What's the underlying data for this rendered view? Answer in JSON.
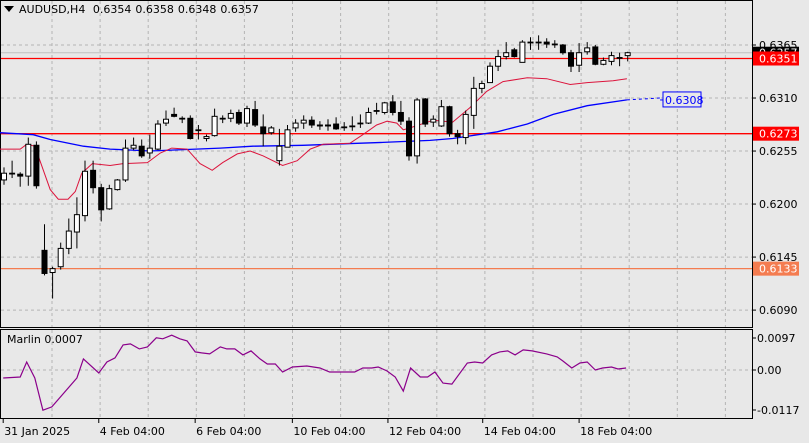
{
  "header": {
    "symbol": "AUDUSD,H4",
    "open": "0.6354",
    "high": "0.6358",
    "low": "0.6348",
    "close": "0.6357"
  },
  "price_axis": {
    "labels": [
      "0.6365",
      "0.6310",
      "0.6255",
      "0.6200",
      "0.6145",
      "0.6090"
    ],
    "current_price": "0.6357"
  },
  "levels": [
    {
      "label": "0.6351",
      "price": 0.6351,
      "color": "#ff0000"
    },
    {
      "label": "0.6273",
      "price": 0.6273,
      "color": "#ff0000"
    },
    {
      "label": "0.6133",
      "price": 0.6133,
      "color": "#f47c50"
    }
  ],
  "ma_label": {
    "label": "0.6308",
    "price": 0.6308,
    "color": "#0000ff"
  },
  "time_axis": {
    "labels": [
      "31 Jan 2025",
      "4 Feb 04:00",
      "6 Feb 04:00",
      "10 Feb 04:00",
      "12 Feb 04:00",
      "14 Feb 04:00",
      "18 Feb 04:00"
    ],
    "label_bars": [
      -0.1,
      11.7,
      23.6,
      35.6,
      47.4,
      59.1,
      71
    ]
  },
  "oscillator": {
    "title": "Marlin 0.0007",
    "axis_labels": [
      "0.0097",
      "0.00",
      "-0.0117"
    ],
    "color": "#8b008b",
    "points": [
      [
        -0.1,
        -0.0024
      ],
      [
        2,
        -0.0021
      ],
      [
        2.8,
        0.0024
      ],
      [
        3.8,
        -0.0024
      ],
      [
        4.8,
        -0.012
      ],
      [
        5.9,
        -0.011
      ],
      [
        9,
        -0.0024
      ],
      [
        9.8,
        0.0033
      ],
      [
        11.7,
        -0.0009
      ],
      [
        12.7,
        0.0024
      ],
      [
        13.7,
        0.0036
      ],
      [
        14.7,
        0.0075
      ],
      [
        15.6,
        0.0078
      ],
      [
        16.7,
        0.0063
      ],
      [
        17.7,
        0.0069
      ],
      [
        18.8,
        0.0096
      ],
      [
        19.6,
        0.0093
      ],
      [
        20.7,
        0.0104
      ],
      [
        21.7,
        0.0093
      ],
      [
        22.6,
        0.0087
      ],
      [
        23.6,
        0.0054
      ],
      [
        24.4,
        0.0051
      ],
      [
        25.4,
        0.0048
      ],
      [
        26.7,
        0.0069
      ],
      [
        27.5,
        0.0063
      ],
      [
        28.5,
        0.0063
      ],
      [
        29.5,
        0.0045
      ],
      [
        30.5,
        0.0057
      ],
      [
        31.6,
        0.0033
      ],
      [
        32.5,
        0.0018
      ],
      [
        33.5,
        0.0018
      ],
      [
        34.4,
        -0.0006
      ],
      [
        35.6,
        0.0009
      ],
      [
        37.4,
        0.0012
      ],
      [
        39,
        0.0006
      ],
      [
        40.2,
        -0.0006
      ],
      [
        43.3,
        -0.0006
      ],
      [
        44.3,
        0.0006
      ],
      [
        45.4,
        0.0006
      ],
      [
        46.2,
        0.0009
      ],
      [
        47.3,
        -0.0003
      ],
      [
        48.3,
        -0.0021
      ],
      [
        49.3,
        -0.0063
      ],
      [
        50.2,
        0.0006
      ],
      [
        51.4,
        -0.0021
      ],
      [
        52.3,
        -0.0021
      ],
      [
        53.2,
        -0.0006
      ],
      [
        54.2,
        -0.0039
      ],
      [
        55.3,
        -0.0042
      ],
      [
        57.2,
        0.0021
      ],
      [
        58.1,
        0.0024
      ],
      [
        59.1,
        0.0021
      ],
      [
        60.2,
        0.0045
      ],
      [
        61.2,
        0.0054
      ],
      [
        62.2,
        0.0057
      ],
      [
        63.1,
        0.0045
      ],
      [
        64.1,
        0.006
      ],
      [
        65.2,
        0.0057
      ],
      [
        67,
        0.0048
      ],
      [
        68.3,
        0.0039
      ],
      [
        69,
        0.0027
      ],
      [
        70.1,
        0.0006
      ],
      [
        71.1,
        0.0021
      ],
      [
        72,
        0.0024
      ],
      [
        73,
        0
      ],
      [
        73.9,
        0.0006
      ],
      [
        75,
        0.0009
      ],
      [
        75.8,
        0.0003
      ],
      [
        76.8,
        0.0006
      ]
    ]
  },
  "chart_data": {
    "type": "candlestick",
    "ohlc": [
      [
        0.6225,
        0.6238,
        0.622,
        0.6232
      ],
      [
        0.6232,
        0.6245,
        0.6227,
        0.6232
      ],
      [
        0.6231,
        0.6233,
        0.6218,
        0.6229
      ],
      [
        0.6229,
        0.6269,
        0.6219,
        0.6262
      ],
      [
        0.6261,
        0.6265,
        0.6216,
        0.6219
      ],
      [
        0.6152,
        0.6179,
        0.6126,
        0.6128
      ],
      [
        0.6129,
        0.6135,
        0.6102,
        0.6133
      ],
      [
        0.6135,
        0.616,
        0.6132,
        0.6154
      ],
      [
        0.6154,
        0.6185,
        0.6148,
        0.6172
      ],
      [
        0.6171,
        0.6207,
        0.6154,
        0.6189
      ],
      [
        0.6188,
        0.6245,
        0.6182,
        0.6234
      ],
      [
        0.6235,
        0.6245,
        0.6211,
        0.6217
      ],
      [
        0.6217,
        0.6221,
        0.6182,
        0.6194
      ],
      [
        0.6195,
        0.622,
        0.6194,
        0.6216
      ],
      [
        0.6215,
        0.6226,
        0.6214,
        0.6225
      ],
      [
        0.6225,
        0.6267,
        0.6223,
        0.6258
      ],
      [
        0.6258,
        0.6269,
        0.6256,
        0.6261
      ],
      [
        0.626,
        0.6267,
        0.6248,
        0.625
      ],
      [
        0.6253,
        0.6272,
        0.6247,
        0.6258
      ],
      [
        0.6257,
        0.6287,
        0.6256,
        0.6283
      ],
      [
        0.6284,
        0.6297,
        0.6281,
        0.6288
      ],
      [
        0.6293,
        0.63,
        0.629,
        0.6291
      ],
      [
        0.6289,
        0.6291,
        0.6284,
        0.6289
      ],
      [
        0.6289,
        0.6292,
        0.6267,
        0.6268
      ],
      [
        0.6277,
        0.6282,
        0.6267,
        0.6277
      ],
      [
        0.6268,
        0.6272,
        0.6265,
        0.627
      ],
      [
        0.6271,
        0.6299,
        0.627,
        0.6291
      ],
      [
        0.6289,
        0.6292,
        0.6284,
        0.6289
      ],
      [
        0.6289,
        0.6298,
        0.6285,
        0.6294
      ],
      [
        0.6295,
        0.6298,
        0.6282,
        0.6284
      ],
      [
        0.6284,
        0.6302,
        0.628,
        0.6299
      ],
      [
        0.6298,
        0.6307,
        0.628,
        0.6282
      ],
      [
        0.628,
        0.6293,
        0.626,
        0.6273
      ],
      [
        0.6274,
        0.6281,
        0.6272,
        0.6279
      ],
      [
        0.6245,
        0.6278,
        0.624,
        0.626
      ],
      [
        0.6259,
        0.6282,
        0.6259,
        0.6277
      ],
      [
        0.6279,
        0.6288,
        0.6275,
        0.6284
      ],
      [
        0.6284,
        0.6292,
        0.6278,
        0.6287
      ],
      [
        0.6287,
        0.6291,
        0.6279,
        0.6282
      ],
      [
        0.6282,
        0.6286,
        0.6277,
        0.6281
      ],
      [
        0.6282,
        0.6288,
        0.6276,
        0.6281
      ],
      [
        0.6283,
        0.629,
        0.6277,
        0.6278
      ],
      [
        0.628,
        0.6285,
        0.6276,
        0.628
      ],
      [
        0.6281,
        0.6291,
        0.6276,
        0.6281
      ],
      [
        0.6284,
        0.6293,
        0.6279,
        0.6284
      ],
      [
        0.6284,
        0.63,
        0.6283,
        0.6295
      ],
      [
        0.6297,
        0.6305,
        0.6293,
        0.6297
      ],
      [
        0.6295,
        0.6306,
        0.6293,
        0.6305
      ],
      [
        0.6306,
        0.6313,
        0.6292,
        0.6295
      ],
      [
        0.6295,
        0.6307,
        0.6282,
        0.6286
      ],
      [
        0.6286,
        0.629,
        0.6245,
        0.625
      ],
      [
        0.625,
        0.631,
        0.6242,
        0.6308
      ],
      [
        0.6309,
        0.631,
        0.628,
        0.6283
      ],
      [
        0.6285,
        0.6292,
        0.628,
        0.6288
      ],
      [
        0.6281,
        0.6308,
        0.628,
        0.6301
      ],
      [
        0.6301,
        0.6302,
        0.627,
        0.6273
      ],
      [
        0.6273,
        0.6277,
        0.6262,
        0.627
      ],
      [
        0.6269,
        0.6297,
        0.6262,
        0.6293
      ],
      [
        0.6292,
        0.6332,
        0.6278,
        0.632
      ],
      [
        0.632,
        0.6328,
        0.6315,
        0.6325
      ],
      [
        0.6326,
        0.6347,
        0.6326,
        0.6343
      ],
      [
        0.6343,
        0.636,
        0.6338,
        0.6353
      ],
      [
        0.6353,
        0.6368,
        0.635,
        0.6357
      ],
      [
        0.636,
        0.6362,
        0.6352,
        0.6353
      ],
      [
        0.6347,
        0.637,
        0.6347,
        0.6368
      ],
      [
        0.6368,
        0.6373,
        0.636,
        0.6368
      ],
      [
        0.6368,
        0.6375,
        0.636,
        0.6368
      ],
      [
        0.6368,
        0.6372,
        0.6362,
        0.6366
      ],
      [
        0.6366,
        0.637,
        0.6362,
        0.6366
      ],
      [
        0.6365,
        0.6366,
        0.6355,
        0.6357
      ],
      [
        0.6357,
        0.636,
        0.6337,
        0.6343
      ],
      [
        0.6344,
        0.6367,
        0.6337,
        0.6357
      ],
      [
        0.6358,
        0.6368,
        0.6355,
        0.6362
      ],
      [
        0.6363,
        0.6365,
        0.6344,
        0.6345
      ],
      [
        0.6345,
        0.6352,
        0.6344,
        0.6349
      ],
      [
        0.6348,
        0.6358,
        0.6344,
        0.6354
      ],
      [
        0.6352,
        0.6357,
        0.6343,
        0.6352
      ],
      [
        0.6354,
        0.6358,
        0.6348,
        0.6357
      ]
    ],
    "ma_fast": {
      "color": "#dc143c",
      "points": [
        [
          -0.5,
          0.6257
        ],
        [
          2,
          0.6257
        ],
        [
          2.8,
          0.6262
        ],
        [
          3.8,
          0.626
        ],
        [
          5.7,
          0.6215
        ],
        [
          6.7,
          0.6205
        ],
        [
          7.9,
          0.6205
        ],
        [
          8.8,
          0.6213
        ],
        [
          9.6,
          0.6232
        ],
        [
          10.9,
          0.6242
        ],
        [
          13.1,
          0.624
        ],
        [
          14.7,
          0.6242
        ],
        [
          17.7,
          0.6243
        ],
        [
          19.3,
          0.6253
        ],
        [
          20.7,
          0.6258
        ],
        [
          22.6,
          0.6257
        ],
        [
          24.2,
          0.6242
        ],
        [
          25.7,
          0.6235
        ],
        [
          27,
          0.6243
        ],
        [
          28.8,
          0.6252
        ],
        [
          30.4,
          0.6255
        ],
        [
          32,
          0.625
        ],
        [
          34.4,
          0.624
        ],
        [
          36.2,
          0.6245
        ],
        [
          37.8,
          0.6257
        ],
        [
          39.4,
          0.6262
        ],
        [
          42.7,
          0.6263
        ],
        [
          44.3,
          0.6272
        ],
        [
          46,
          0.6282
        ],
        [
          47.3,
          0.6286
        ],
        [
          48.5,
          0.6284
        ],
        [
          49.3,
          0.6277
        ],
        [
          50.5,
          0.628
        ],
        [
          53,
          0.6287
        ],
        [
          55.4,
          0.6285
        ],
        [
          57.5,
          0.63
        ],
        [
          59.6,
          0.6317
        ],
        [
          61.6,
          0.6327
        ],
        [
          64.6,
          0.6331
        ],
        [
          67,
          0.633
        ],
        [
          69.9,
          0.6324
        ],
        [
          72,
          0.6326
        ],
        [
          75.2,
          0.6328
        ],
        [
          76.9,
          0.633
        ]
      ]
    },
    "ma_slow": {
      "color": "#0000ff",
      "points": [
        [
          -0.5,
          0.6274
        ],
        [
          3.6,
          0.6272
        ],
        [
          5.7,
          0.6267
        ],
        [
          9.8,
          0.626
        ],
        [
          13.1,
          0.6257
        ],
        [
          18,
          0.6255
        ],
        [
          26.7,
          0.6258
        ],
        [
          30.7,
          0.626
        ],
        [
          36.9,
          0.6261
        ],
        [
          43.6,
          0.6263
        ],
        [
          46.8,
          0.6264
        ],
        [
          52.6,
          0.6266
        ],
        [
          55.4,
          0.6268
        ],
        [
          60.9,
          0.6275
        ],
        [
          64.6,
          0.6283
        ],
        [
          67.8,
          0.6293
        ],
        [
          72,
          0.6302
        ],
        [
          76.9,
          0.6308
        ]
      ],
      "projection": [
        [
          76.9,
          0.6308
        ],
        [
          81,
          0.631
        ]
      ]
    },
    "ylim": [
      0.608,
      0.639
    ]
  }
}
